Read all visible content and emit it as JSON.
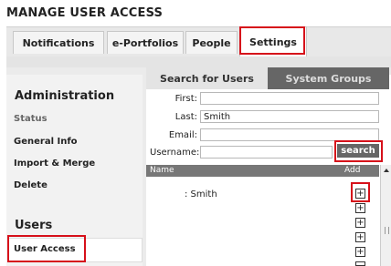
{
  "page_title": "MANAGE USER ACCESS",
  "tabs": [
    "Notifications",
    "e-Portfolios",
    "People",
    "Settings"
  ],
  "active_tab": "Settings",
  "sidebar": {
    "administration_heading": "Administration",
    "admin_items": [
      "Status",
      "General Info",
      "Import & Merge",
      "Delete"
    ],
    "users_heading": "Users",
    "users_items": [
      "User Access"
    ]
  },
  "panel_tabs": [
    "Search for Users",
    "System Groups"
  ],
  "form": {
    "first_label": "First:",
    "first_value": "",
    "last_label": "Last:",
    "last_value": "Smith",
    "email_label": "Email:",
    "email_value": "",
    "username_label": "Username:",
    "username_value": "",
    "search_button": "search"
  },
  "results": {
    "columns": [
      "Name",
      "Add"
    ],
    "rows": [
      ": Smith"
    ],
    "add_symbol": "+"
  },
  "colors": {
    "highlight": "#d6101a",
    "panel_dark": "#666666"
  }
}
